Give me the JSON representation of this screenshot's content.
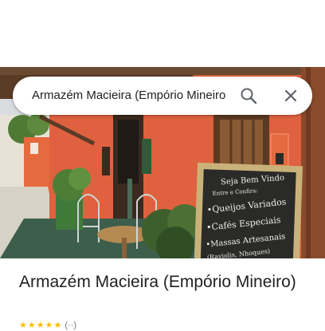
{
  "search": {
    "query": "Armazém Macieira (Empório Mineiro"
  },
  "place": {
    "title": "Armazém Macieira (Empório Mineiro)",
    "stars": "★★★★★",
    "rating_count": "(··)"
  },
  "photo": {
    "chalkboard_lines": [
      "Seja Bem Vindo",
      "Entre e Confira:",
      "•Queijos Variados",
      "•Cafés Especiais",
      "•Massas Artesanais",
      "(Raviolis, Nhoques)"
    ]
  },
  "icons": {
    "search": "search-icon",
    "close": "close-icon"
  },
  "colors": {
    "wall": "#e0613f",
    "chalkboard": "#2a2a28",
    "frame": "#c9b27a",
    "star": "#fbbc04"
  }
}
